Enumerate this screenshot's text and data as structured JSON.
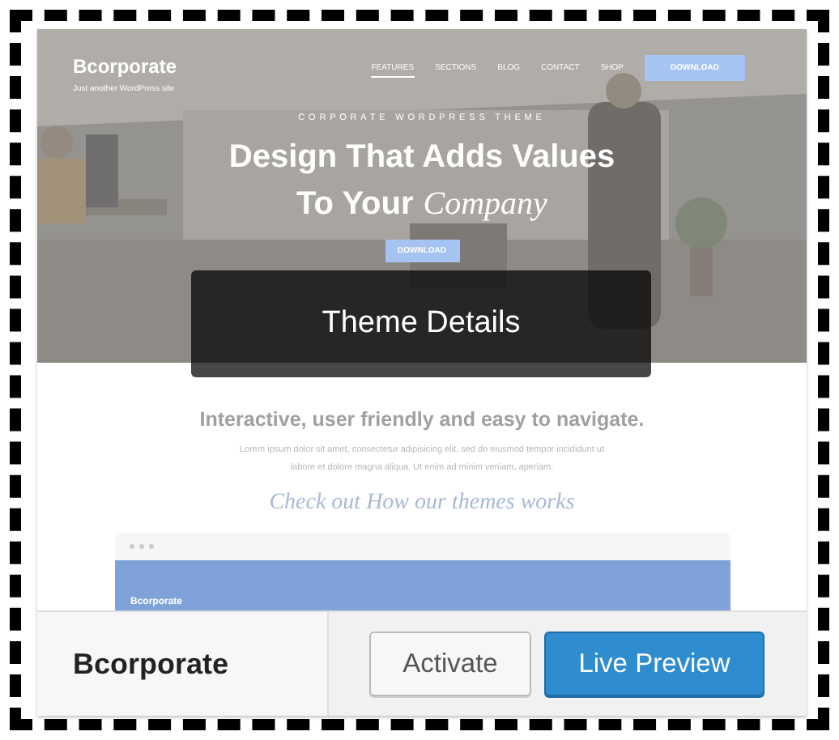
{
  "hero": {
    "logo": "Bcorporate",
    "tagline": "Just another WordPress site",
    "nav": [
      {
        "label": "FEATURES",
        "selected": true
      },
      {
        "label": "SECTIONS",
        "selected": false
      },
      {
        "label": "BLOG",
        "selected": false
      },
      {
        "label": "CONTACT",
        "selected": false
      },
      {
        "label": "SHOP",
        "selected": false
      }
    ],
    "download": "DOWNLOAD",
    "eyebrow": "CORPORATE WORDPRESS THEME",
    "headline_1": "Design That Adds Values",
    "headline_2": "To Your",
    "headline_script": "Company",
    "cta": "DOWNLOAD"
  },
  "section": {
    "heading": "Interactive, user friendly and easy to navigate.",
    "body": "Lorem ipsum dolor sit amet, consectetur adipisicing elit, sed do eiusmod tempor incididunt ut labore et dolore magna aliqua. Ut enim ad minim veniam, aperiam.",
    "script_link": "Check out How our themes works"
  },
  "mini_browser": {
    "title": "Bcorporate"
  },
  "overlay": {
    "label": "Theme Details"
  },
  "footer": {
    "theme_name": "Bcorporate",
    "buttons": [
      {
        "label": "Activate",
        "kind": "secondary"
      },
      {
        "label": "Live Preview",
        "kind": "primary"
      }
    ]
  }
}
